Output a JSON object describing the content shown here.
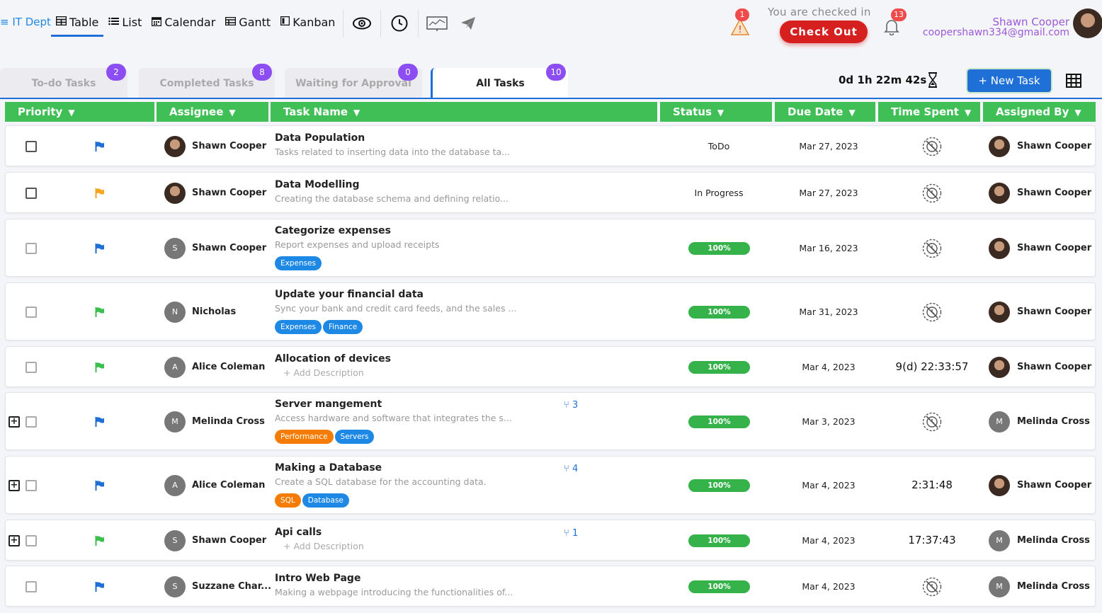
{
  "header": {
    "project": "IT Dept",
    "views": [
      {
        "label": "Table",
        "icon": "table-icon",
        "active": true
      },
      {
        "label": "List",
        "icon": "list-icon"
      },
      {
        "label": "Calendar",
        "icon": "calendar-icon"
      },
      {
        "label": "Gantt",
        "icon": "gantt-icon"
      },
      {
        "label": "Kanban",
        "icon": "kanban-icon"
      }
    ],
    "alert_count": "1",
    "checked_in_text": "You are checked in",
    "checkout_label": "Check Out",
    "notification_count": "13",
    "user_name": "Shawn Cooper",
    "user_email": "coopershawn334@gmail.com"
  },
  "tabs": [
    {
      "label": "To-do Tasks",
      "count": "2"
    },
    {
      "label": "Completed Tasks",
      "count": "8"
    },
    {
      "label": "Waiting for Approval",
      "count": "0"
    },
    {
      "label": "All Tasks",
      "count": "10",
      "active": true
    }
  ],
  "toolbar": {
    "timer": "0d 1h 22m 42s",
    "new_task_label": "New Task"
  },
  "columns": [
    "Priority",
    "Assignee",
    "Task Name",
    "Status",
    "Due Date",
    "Time Spent",
    "Assigned By"
  ],
  "colors": {
    "accent": "#1e70d8",
    "header_green": "#3fbf55",
    "flag_blue": "#1e6fd6",
    "flag_orange": "#f5a623",
    "flag_green": "#3bbf4f",
    "badge_purple": "#8c4df2"
  },
  "rows": [
    {
      "flag": "blue",
      "assignee": "Shawn Cooper",
      "assignee_avatar": "photo",
      "name": "Data Population",
      "desc": "Tasks related to inserting data into the database ta...",
      "tags": [],
      "status": "ToDo",
      "due": "Mar 27, 2023",
      "time_spent": "",
      "assigned_by": "Shawn Cooper",
      "assigned_by_avatar": "photo"
    },
    {
      "flag": "orange",
      "assignee": "Shawn Cooper",
      "assignee_avatar": "photo",
      "name": "Data Modelling",
      "desc": "Creating the database schema and defining relatio...",
      "tags": [],
      "status": "In Progress",
      "due": "Mar 27, 2023",
      "time_spent": "",
      "assigned_by": "Shawn Cooper",
      "assigned_by_avatar": "photo"
    },
    {
      "flag": "blue",
      "assignee": "Shawn Cooper",
      "assignee_avatar": "S",
      "name": "Categorize expenses",
      "desc": "Report expenses and upload receipts",
      "tags": [
        {
          "label": "Expenses",
          "color": "#1e88e5"
        }
      ],
      "progress": "100%",
      "due": "Mar 16, 2023",
      "time_spent": "",
      "assigned_by": "Shawn Cooper",
      "assigned_by_avatar": "photo"
    },
    {
      "flag": "green",
      "assignee": "Nicholas",
      "assignee_avatar": "N",
      "name": "Update your financial data",
      "desc": "Sync your bank and credit card feeds, and the sales ...",
      "tags": [
        {
          "label": "Expenses",
          "color": "#1e88e5"
        },
        {
          "label": "Finance",
          "color": "#1e88e5"
        }
      ],
      "progress": "100%",
      "due": "Mar 31, 2023",
      "time_spent": "",
      "assigned_by": "Shawn Cooper",
      "assigned_by_avatar": "photo"
    },
    {
      "flag": "green",
      "assignee": "Alice Coleman",
      "assignee_avatar": "A",
      "name": "Allocation of devices",
      "desc": "+ Add Description",
      "tags": [],
      "progress": "100%",
      "due": "Mar 4, 2023",
      "time_spent": "9(d) 22:33:57",
      "assigned_by": "Shawn Cooper",
      "assigned_by_avatar": "photo"
    },
    {
      "flag": "blue",
      "expand": true,
      "assignee": "Melinda Cross",
      "assignee_avatar": "M",
      "name": "Server mangement",
      "desc": "Access hardware and software that integrates the s...",
      "subtasks": "3",
      "tags": [
        {
          "label": "Performance",
          "color": "#f57c00"
        },
        {
          "label": "Servers",
          "color": "#1e88e5"
        }
      ],
      "progress": "100%",
      "due": "Mar 3, 2023",
      "time_spent": "",
      "assigned_by": "Melinda Cross",
      "assigned_by_avatar": "M"
    },
    {
      "flag": "blue",
      "expand": true,
      "assignee": "Alice Coleman",
      "assignee_avatar": "A",
      "name": "Making a Database",
      "desc": "Create a SQL database for the accounting data.",
      "subtasks": "4",
      "tags": [
        {
          "label": "SQL",
          "color": "#f57c00"
        },
        {
          "label": "Database",
          "color": "#1e88e5"
        }
      ],
      "progress": "100%",
      "due": "Mar 4, 2023",
      "time_spent": "2:31:48",
      "assigned_by": "Shawn Cooper",
      "assigned_by_avatar": "photo"
    },
    {
      "flag": "green",
      "expand": true,
      "assignee": "Shawn Cooper",
      "assignee_avatar": "S",
      "name": "Api calls",
      "desc": "+ Add Description",
      "subtasks": "1",
      "tags": [],
      "progress": "100%",
      "due": "Mar 4, 2023",
      "time_spent": "17:37:43",
      "assigned_by": "Melinda Cross",
      "assigned_by_avatar": "M"
    },
    {
      "flag": "blue",
      "assignee": "Suzzane Char...",
      "assignee_avatar": "S",
      "name": "Intro Web Page",
      "desc": "Making a webpage introducing the functionalities of...",
      "tags": [],
      "progress": "100%",
      "due": "Mar 4, 2023",
      "time_spent": "",
      "assigned_by": "Melinda Cross",
      "assigned_by_avatar": "M"
    }
  ]
}
